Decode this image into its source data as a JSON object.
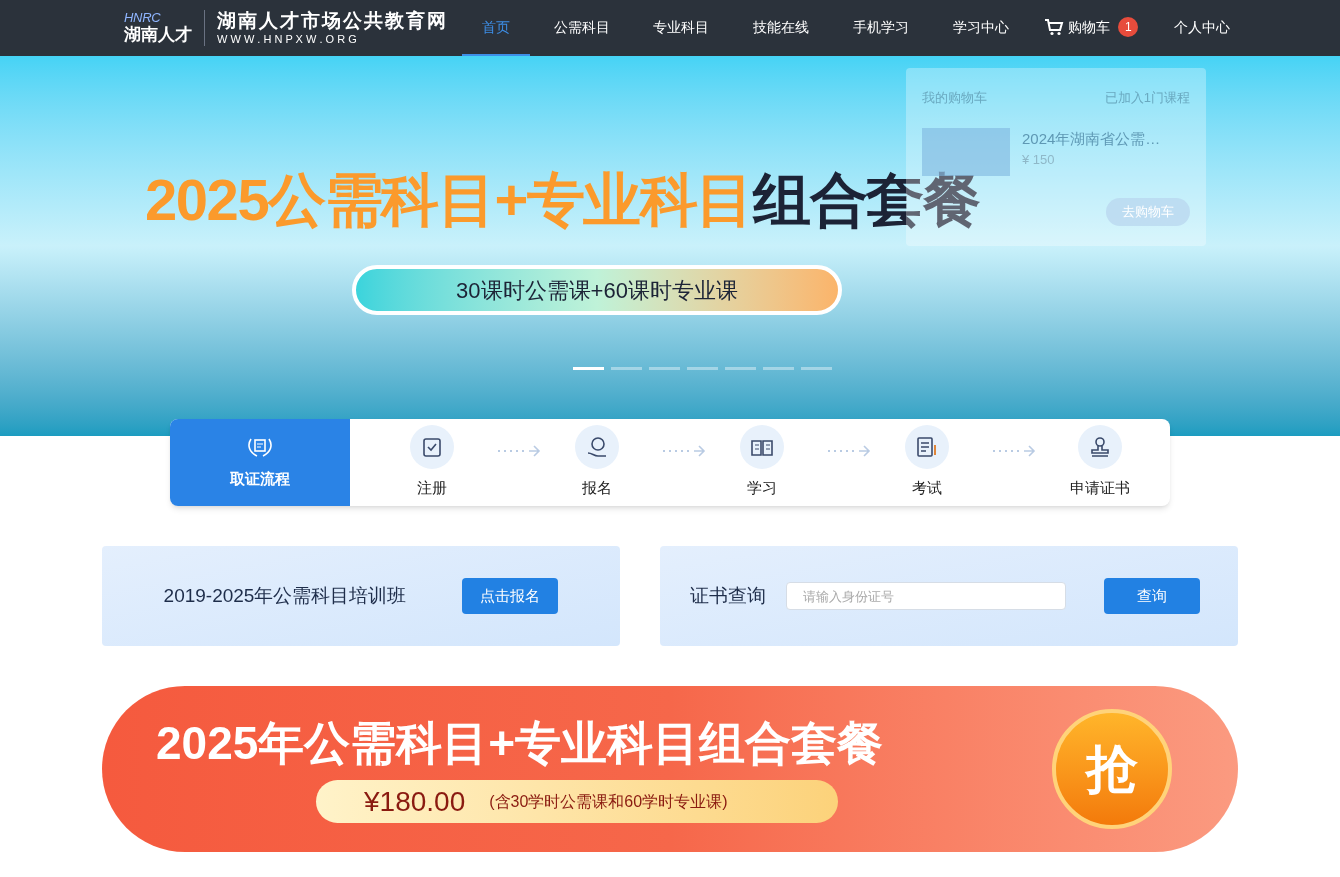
{
  "header": {
    "logo_mark": "HNRC",
    "logo_name": "湖南人才",
    "site_title": "湖南人才市场公共教育网",
    "site_url": "W W W . H N P X W . O R G",
    "nav": [
      {
        "label": "首页",
        "selected": true,
        "kind": "link"
      },
      {
        "label": "公需科目",
        "selected": false,
        "kind": "link"
      },
      {
        "label": "专业科目",
        "selected": false,
        "kind": "link"
      },
      {
        "label": "技能在线",
        "selected": false,
        "kind": "link"
      },
      {
        "label": "手机学习",
        "selected": false,
        "kind": "link"
      },
      {
        "label": "学习中心",
        "selected": false,
        "kind": "link"
      },
      {
        "label": "购物车",
        "selected": false,
        "kind": "cart",
        "badge": "1"
      },
      {
        "label": "个人中心",
        "selected": false,
        "kind": "link"
      }
    ]
  },
  "cart_popup": {
    "title": "我的购物车",
    "count_text": "已加入1门课程",
    "item": {
      "title": "2024年湖南省公需…",
      "price": "¥ 150"
    },
    "button": "去购物车"
  },
  "hero": {
    "headline_orange": "2025公需科目+专业科目",
    "headline_dark": "组合套餐",
    "subline": "30课时公需课+60课时专业课",
    "dots": [
      {
        "selected": true
      },
      {
        "selected": false
      },
      {
        "selected": false
      },
      {
        "selected": false
      },
      {
        "selected": false
      },
      {
        "selected": false
      },
      {
        "selected": false
      }
    ]
  },
  "process": {
    "title": "取证流程",
    "steps": [
      {
        "label": "注册",
        "kind": "register"
      },
      {
        "label": "报名",
        "kind": "enroll"
      },
      {
        "label": "学习",
        "kind": "study"
      },
      {
        "label": "考试",
        "kind": "exam"
      },
      {
        "label": "申请证书",
        "kind": "certificate"
      }
    ]
  },
  "training": {
    "text": "2019-2025年公需科目培训班",
    "button": "点击报名"
  },
  "cert_query": {
    "label": "证书查询",
    "placeholder": "请输入身份证号",
    "button": "查询"
  },
  "promo": {
    "headline": "2025年公需科目+专业科目组合套餐",
    "price": "¥180.00",
    "note": "(含30学时公需课和60学时专业课)",
    "grab": "抢"
  }
}
